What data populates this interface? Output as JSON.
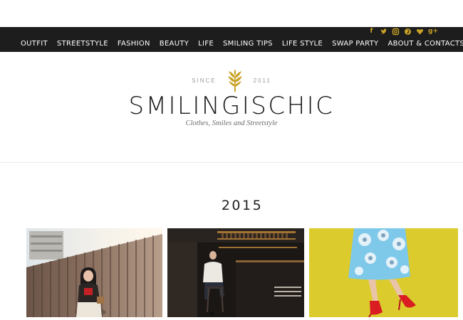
{
  "nav": {
    "items": [
      "OUTFIT",
      "STREETSTYLE",
      "FASHION",
      "BEAUTY",
      "LIFE",
      "SMILING TIPS",
      "LIFE STYLE",
      "SWAP PARTY",
      "ABOUT & CONTACTS"
    ],
    "social_icons": [
      "facebook-icon",
      "twitter-icon",
      "instagram-icon",
      "pinterest-icon",
      "bloglovin-heart-icon",
      "google-plus-icon"
    ],
    "social_glyphs": {
      "facebook": "f",
      "google_plus": "g+"
    }
  },
  "brand": {
    "since_label": "SINCE",
    "year_label": "2011",
    "title": "SMILINGISCHIC",
    "tagline": "Clothes, Smiles and Streetstyle"
  },
  "archive": {
    "year": "2015"
  },
  "gallery": [
    "outfit-photo-fence",
    "bar-interior-photo",
    "skirt-red-heels-photo"
  ],
  "colors": {
    "nav_background": "#1d1d1d",
    "accent_gold": "#c9a227",
    "nav_text": "#ffffff"
  }
}
